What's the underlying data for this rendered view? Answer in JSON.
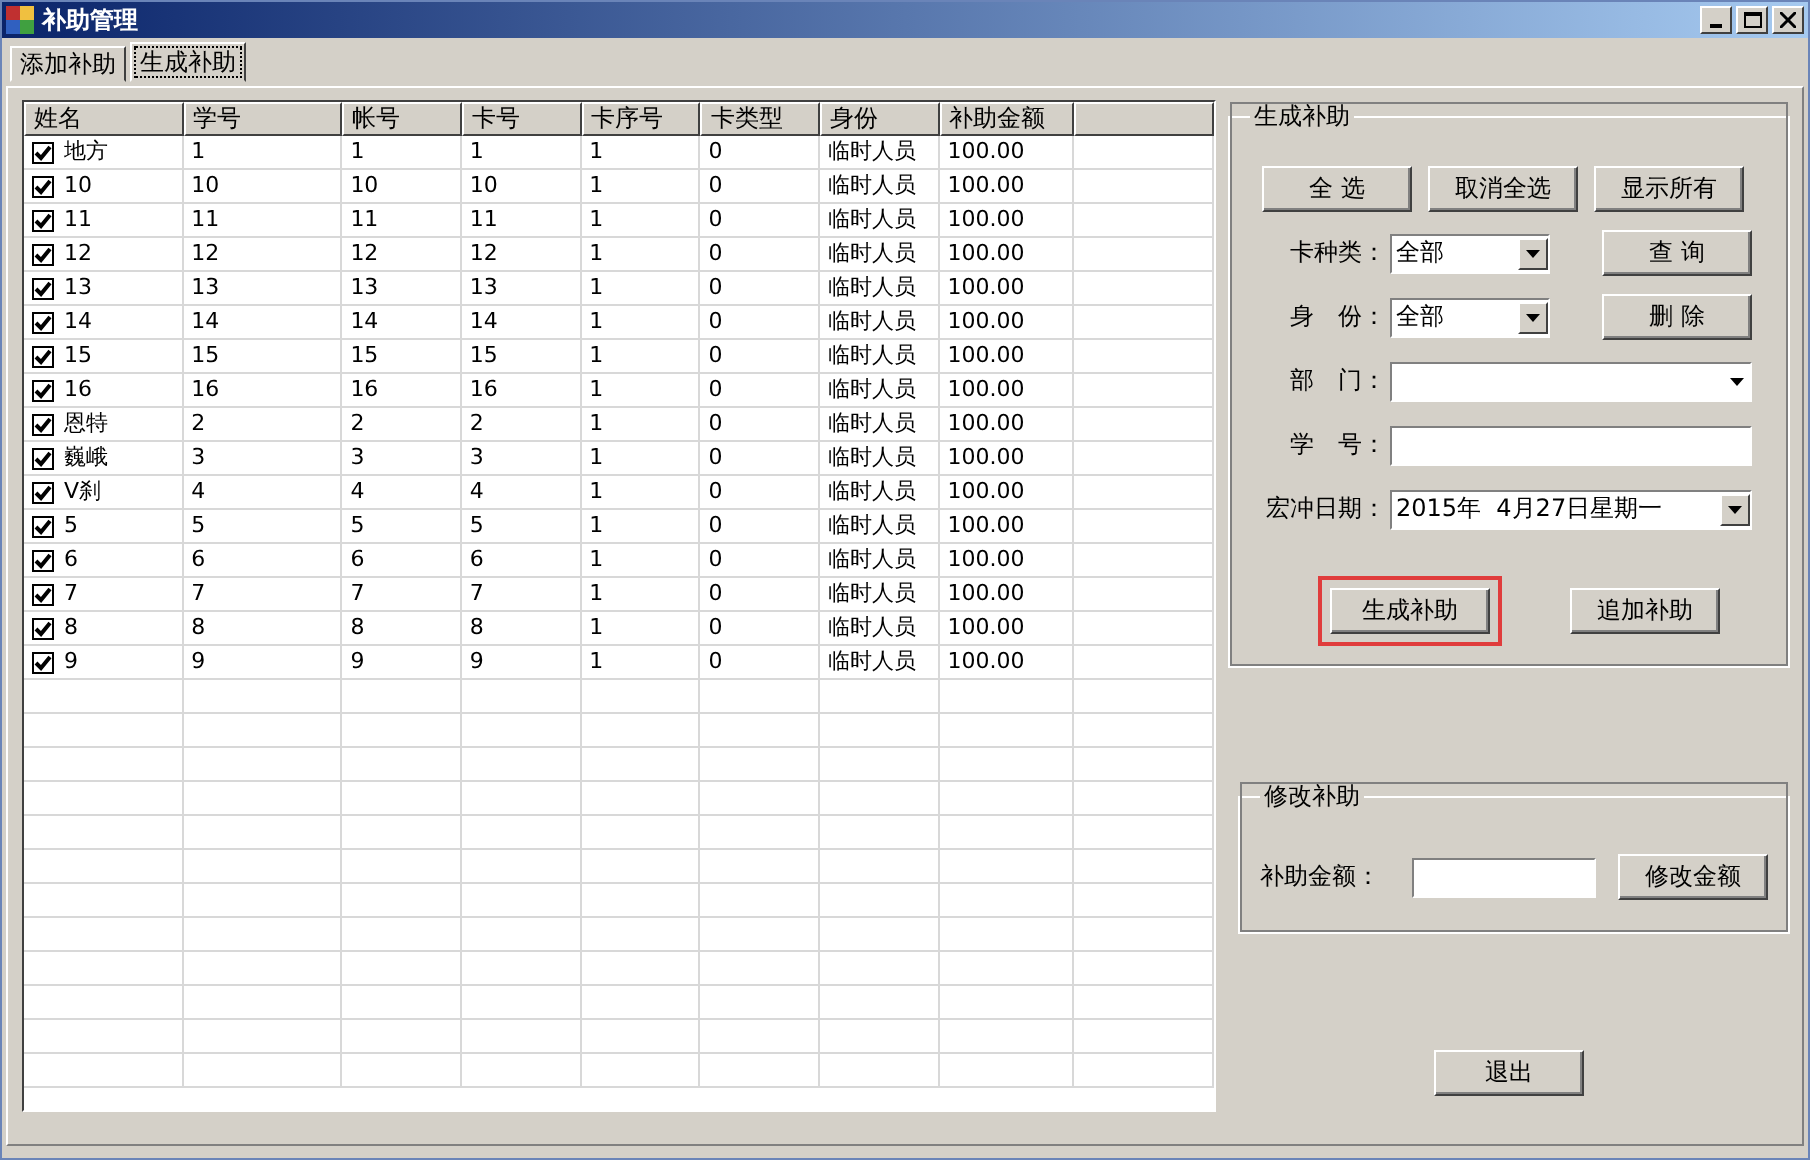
{
  "window": {
    "title": "补助管理"
  },
  "tabs": [
    {
      "label": "添加补助",
      "selected": false
    },
    {
      "label": "生成补助",
      "selected": true
    }
  ],
  "table": {
    "columns": [
      "姓名",
      "学号",
      "帐号",
      "卡号",
      "卡序号",
      "卡类型",
      "身份",
      "补助金额"
    ],
    "rows": [
      {
        "checked": true,
        "cells": [
          "地方",
          "1",
          "1",
          "1",
          "1",
          "0",
          "临时人员",
          "100.00"
        ]
      },
      {
        "checked": true,
        "cells": [
          "10",
          "10",
          "10",
          "10",
          "1",
          "0",
          "临时人员",
          "100.00"
        ]
      },
      {
        "checked": true,
        "cells": [
          "11",
          "11",
          "11",
          "11",
          "1",
          "0",
          "临时人员",
          "100.00"
        ]
      },
      {
        "checked": true,
        "cells": [
          "12",
          "12",
          "12",
          "12",
          "1",
          "0",
          "临时人员",
          "100.00"
        ]
      },
      {
        "checked": true,
        "cells": [
          "13",
          "13",
          "13",
          "13",
          "1",
          "0",
          "临时人员",
          "100.00"
        ]
      },
      {
        "checked": true,
        "cells": [
          "14",
          "14",
          "14",
          "14",
          "1",
          "0",
          "临时人员",
          "100.00"
        ]
      },
      {
        "checked": true,
        "cells": [
          "15",
          "15",
          "15",
          "15",
          "1",
          "0",
          "临时人员",
          "100.00"
        ]
      },
      {
        "checked": true,
        "cells": [
          "16",
          "16",
          "16",
          "16",
          "1",
          "0",
          "临时人员",
          "100.00"
        ]
      },
      {
        "checked": true,
        "cells": [
          "恩特",
          "2",
          "2",
          "2",
          "1",
          "0",
          "临时人员",
          "100.00"
        ]
      },
      {
        "checked": true,
        "cells": [
          "巍峨",
          "3",
          "3",
          "3",
          "1",
          "0",
          "临时人员",
          "100.00"
        ]
      },
      {
        "checked": true,
        "cells": [
          "V刹",
          "4",
          "4",
          "4",
          "1",
          "0",
          "临时人员",
          "100.00"
        ]
      },
      {
        "checked": true,
        "cells": [
          "5",
          "5",
          "5",
          "5",
          "1",
          "0",
          "临时人员",
          "100.00"
        ]
      },
      {
        "checked": true,
        "cells": [
          "6",
          "6",
          "6",
          "6",
          "1",
          "0",
          "临时人员",
          "100.00"
        ]
      },
      {
        "checked": true,
        "cells": [
          "7",
          "7",
          "7",
          "7",
          "1",
          "0",
          "临时人员",
          "100.00"
        ]
      },
      {
        "checked": true,
        "cells": [
          "8",
          "8",
          "8",
          "8",
          "1",
          "0",
          "临时人员",
          "100.00"
        ]
      },
      {
        "checked": true,
        "cells": [
          "9",
          "9",
          "9",
          "9",
          "1",
          "0",
          "临时人员",
          "100.00"
        ]
      }
    ]
  },
  "generate": {
    "title": "生成补助",
    "top_buttons": [
      "全 选",
      "取消全选",
      "显示所有"
    ],
    "card_type": {
      "label": "卡种类：",
      "value": "全部"
    },
    "query_button": "查 询",
    "identity": {
      "label": "身　份：",
      "value": "全部"
    },
    "delete_button": "删 除",
    "department": {
      "label": "部　门："
    },
    "student_no": {
      "label": "学　号："
    },
    "date": {
      "label": "宏冲日期：",
      "value": "2015年  4月27日星期一"
    },
    "generate_button": {
      "label": "生成补助",
      "highlighted": true
    },
    "append_button": "追加补助"
  },
  "modify": {
    "title": "修改补助",
    "label": "补助金额：",
    "button": "修改金额"
  },
  "exit_button": "退出"
}
